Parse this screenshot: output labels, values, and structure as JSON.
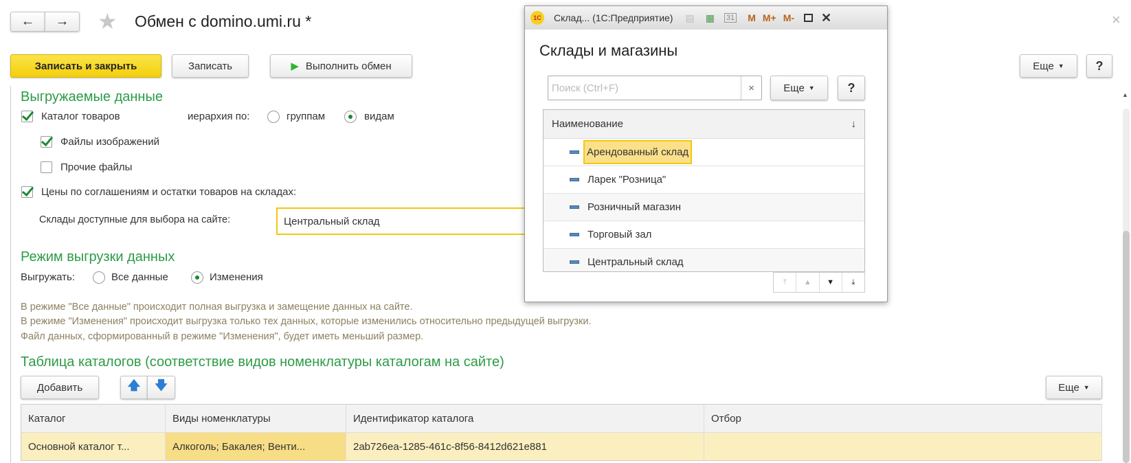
{
  "header": {
    "title": "Обмен с domino.umi.ru *",
    "close": "×"
  },
  "toolbar": {
    "save_close": "Записать и закрыть",
    "save": "Записать",
    "run": "Выполнить обмен",
    "more": "Еще",
    "help": "?"
  },
  "export": {
    "heading": "Выгружаемые данные",
    "catalog": "Каталог товаров",
    "hierarchy_label": "иерархия по:",
    "hier_groups": "группам",
    "hier_kinds": "видам",
    "images": "Файлы изображений",
    "other_files": "Прочие файлы",
    "prices": "Цены по соглашениям и остатки товаров на складах:",
    "warehouses_label": "Склады доступные для выбора на сайте:",
    "warehouses_value": "Центральный склад"
  },
  "mode": {
    "heading": "Режим выгрузки данных",
    "label": "Выгружать:",
    "all": "Все данные",
    "changes": "Изменения",
    "info": [
      "В режиме \"Все данные\" происходит полная выгрузка  и замещение данных на сайте.",
      "В режиме \"Изменения\" происходит выгрузка только тех данных, которые изменились относительно предыдущей выгрузки.",
      "Файл данных, сформированный в режиме \"Изменения\", будет иметь меньший размер."
    ]
  },
  "catalogs": {
    "heading": "Таблица каталогов (соответствие видов номенклатуры каталогам на сайте)",
    "add": "Добавить",
    "more": "Еще",
    "columns": [
      "Каталог",
      "Виды номенклатуры",
      "Идентификатор каталога",
      "Отбор"
    ],
    "rows": [
      [
        "Основной каталог т...",
        "Алкоголь; Бакалея; Венти...",
        "2ab726ea-1285-461c-8f56-8412d621e881",
        ""
      ]
    ]
  },
  "dialog": {
    "window_title": "Склад... (1С:Предприятие)",
    "logo": "1С",
    "title_buttons": [
      "M",
      "M+",
      "M-"
    ],
    "heading": "Склады и магазины",
    "search_placeholder": "Поиск (Ctrl+F)",
    "clear": "×",
    "more": "Еще",
    "help": "?",
    "column": "Наименование",
    "sort": "↓",
    "items": [
      "Арендованный склад",
      "Ларек \"Розница\"",
      "Розничный магазин",
      "Торговый зал",
      "Центральный склад"
    ]
  }
}
